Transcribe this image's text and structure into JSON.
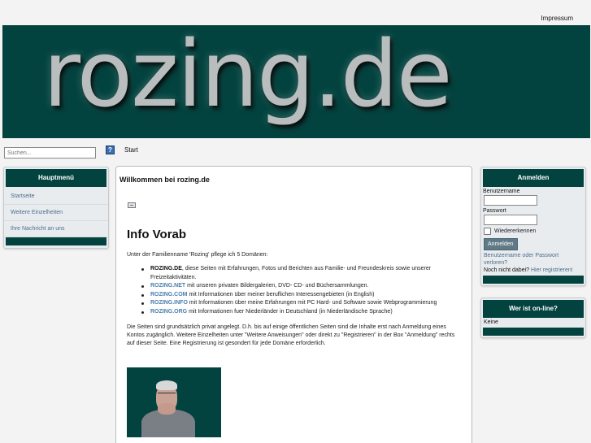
{
  "top_nav": {
    "impressum": "Impressum"
  },
  "banner": {
    "logo_text": "rozing.de"
  },
  "search": {
    "placeholder": "Suchen...",
    "help_icon": "question-mark-icon"
  },
  "breadcrumb": "Start",
  "main_menu": {
    "title": "Hauptmenü",
    "items": [
      "Startseite",
      "Weitere Einzelheiten",
      "Ihre Nachricht an uns"
    ]
  },
  "content": {
    "page_title": "Willkommen bei rozing.de",
    "article_title": "Info Vorab",
    "intro": "Unter der Familienname 'Rozing' pflege ich 5 Domänen:",
    "domains": [
      {
        "name": "ROZING.DE",
        "text": ", diese Seiten mit Erfahrungen, Fotos und Berichten aus Familie- und Freundeskreis sowie unserer Freizeitaktivitäten."
      },
      {
        "name": "ROZING.NET",
        "text": " mit unseren privaten Bildergalerien, DVD- CD- und Büchersammlungen."
      },
      {
        "name": "ROZING.COM",
        "text": " mit Informationen über meiner beruflichen Interessengebieten (in English)"
      },
      {
        "name": "ROZING.INFO",
        "text": " mit Informationen über meine Erfahrungen mit PC Hard- und Software sowie Webprogrammierung"
      },
      {
        "name": "ROZING.ORG",
        "text": " mit Informationen fuer Niederländer in Deutschland (in Niederländische Sprache)"
      }
    ],
    "body": "Die Seiten sind grundsätzlich privat angelegt. D.h. bis auf einige öffentlichen Seiten sind die Inhalte erst nach Anmeldung eines Kontos zugänglich. Weitere Einzelheiten unter \"Weitere Anweisungen\" oder direkt zu \"Registrieren\" in der Box \"Anmeldung\" rechts auf dieser Seite. Eine Registrierung ist gesondert für jede Domäne erforderlich."
  },
  "login": {
    "title": "Anmelden",
    "username_label": "Benutzername",
    "password_label": "Passwort",
    "remember_label": "Wiedererkennen",
    "button": "Anmelden",
    "forgot": "Benutzername oder Passwort verloren?",
    "no_account": "Noch nicht dabei?",
    "register": "Hier registrieren!"
  },
  "online": {
    "title": "Wer ist on-line?",
    "value": "Keine"
  },
  "colors": {
    "brand": "#03433f",
    "link": "#4d6d8c",
    "background": "#f3f3f3"
  }
}
